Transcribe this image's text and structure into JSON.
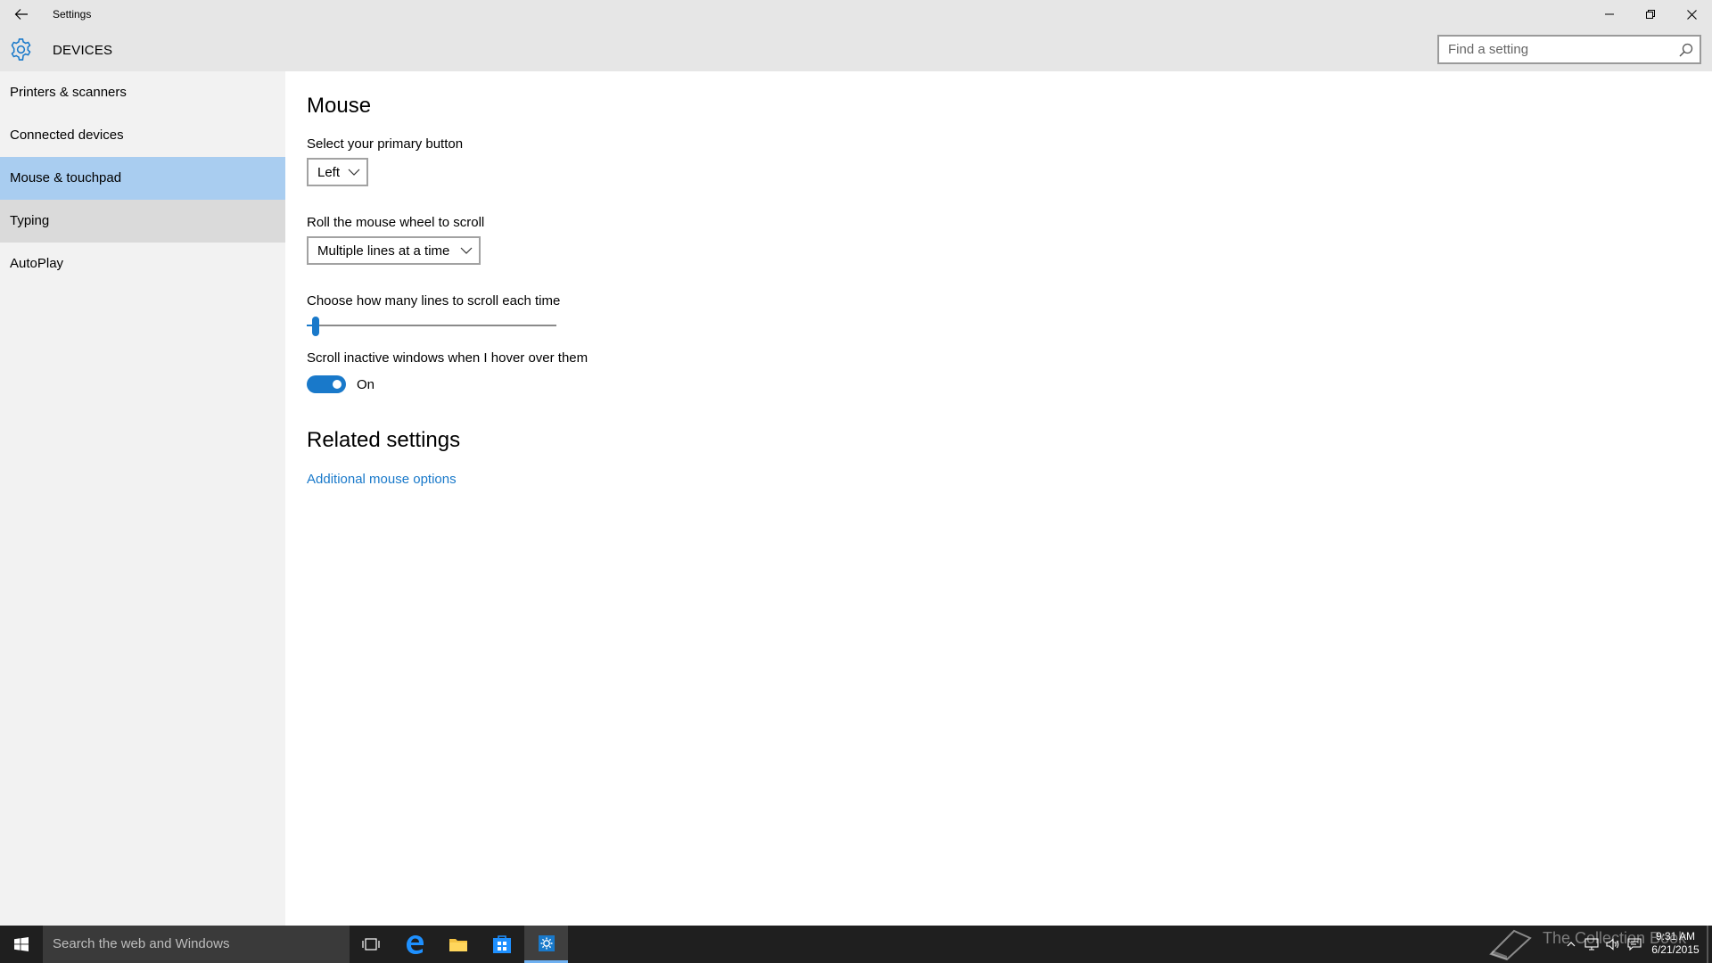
{
  "window": {
    "title": "Settings"
  },
  "header": {
    "section_title": "DEVICES",
    "search_placeholder": "Find a setting"
  },
  "sidebar": {
    "items": [
      {
        "label": "Printers & scanners"
      },
      {
        "label": "Connected devices"
      },
      {
        "label": "Mouse & touchpad"
      },
      {
        "label": "Typing"
      },
      {
        "label": "AutoPlay"
      }
    ]
  },
  "main": {
    "heading": "Mouse",
    "primary_button": {
      "label": "Select your primary button",
      "value": "Left"
    },
    "scroll_mode": {
      "label": "Roll the mouse wheel to scroll",
      "value": "Multiple lines at a time"
    },
    "scroll_lines": {
      "label": "Choose how many lines to scroll each time",
      "fraction": 0.03
    },
    "inactive_scroll": {
      "label": "Scroll inactive windows when I hover over them",
      "state": "On"
    },
    "related": {
      "heading": "Related settings",
      "link": "Additional mouse options"
    }
  },
  "taskbar": {
    "search_placeholder": "Search the web and Windows",
    "watermark": "The Collection Book",
    "time": "9:31 AM",
    "date": "6/21/2015"
  },
  "colors": {
    "accent": "#1979ca",
    "selected_nav": "#a9cdf0",
    "chrome": "#e6e6e6",
    "sidebar": "#f2f2f2",
    "taskbar": "#1f1f1f"
  }
}
